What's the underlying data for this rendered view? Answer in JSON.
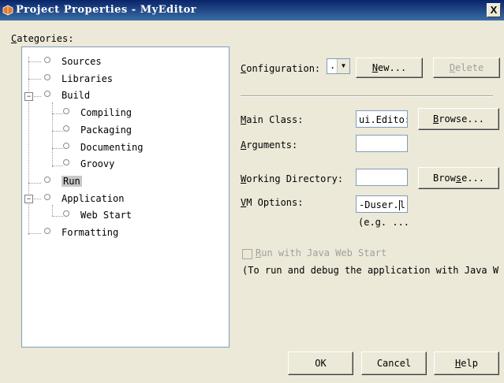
{
  "window": {
    "title": "Project Properties - MyEditor",
    "close_glyph": "X"
  },
  "categories": {
    "label_accel": "C",
    "label_rest": "ategories:",
    "items": [
      {
        "label": "Sources"
      },
      {
        "label": "Libraries"
      },
      {
        "label": "Build"
      },
      {
        "label": "Compiling"
      },
      {
        "label": "Packaging"
      },
      {
        "label": "Documenting"
      },
      {
        "label": "Groovy"
      },
      {
        "label": "Run"
      },
      {
        "label": "Application"
      },
      {
        "label": "Web Start"
      },
      {
        "label": "Formatting"
      }
    ],
    "selected": "Run"
  },
  "config": {
    "label_accel": "C",
    "label_rest": "onfiguration:",
    "value": ".",
    "new_accel": "N",
    "new_rest": "ew...",
    "delete_accel": "D",
    "delete_rest": "elete"
  },
  "main_class": {
    "label_accel": "M",
    "label_rest": "ain Class:",
    "value": "ui.Edito:",
    "browse_accel": "B",
    "browse_rest": "rowse..."
  },
  "arguments": {
    "label_accel": "A",
    "label_rest": "rguments:",
    "value": ""
  },
  "working_dir": {
    "label_accel": "W",
    "label_rest": "orking Directory:",
    "value": "",
    "browse_pre": "Brow",
    "browse_accel": "s",
    "browse_post": "e..."
  },
  "vm_options": {
    "label_accel": "V",
    "label_rest": "M Options:",
    "value": "-Duser.",
    "value_tail": "l",
    "hint": "(e.g. ..."
  },
  "run_web_start": {
    "label_accel": "R",
    "label_rest": "un with Java Web Start",
    "checked": false,
    "note": "(To run and debug the application with Java W"
  },
  "footer": {
    "ok": "OK",
    "cancel": "Cancel",
    "help_accel": "H",
    "help_rest": "elp"
  }
}
